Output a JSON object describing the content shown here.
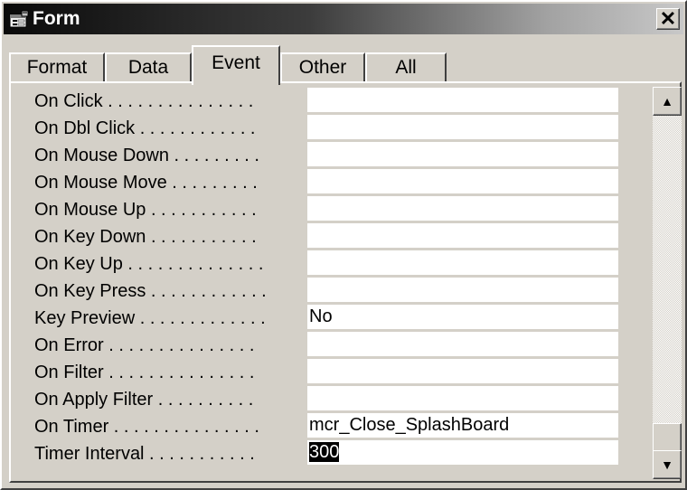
{
  "window": {
    "title": "Form",
    "close_glyph": "✕",
    "icon": "form-properties-icon"
  },
  "tabs": [
    {
      "label": "Format",
      "active": false
    },
    {
      "label": "Data",
      "active": false
    },
    {
      "label": "Event",
      "active": true
    },
    {
      "label": "Other",
      "active": false
    },
    {
      "label": "All",
      "active": false
    }
  ],
  "properties": [
    {
      "label": "On Click . . . . . . . . . . . . . . .",
      "value": ""
    },
    {
      "label": "On Dbl Click . . . . . . . . . . . .",
      "value": ""
    },
    {
      "label": "On Mouse Down . . . . . . . . .",
      "value": ""
    },
    {
      "label": "On Mouse Move . . . . . . . . .",
      "value": ""
    },
    {
      "label": "On Mouse Up . . . . . . . . . . .",
      "value": ""
    },
    {
      "label": "On Key Down . . . . . . . . . . .",
      "value": ""
    },
    {
      "label": "On Key Up . . . . . . . . . . . . . .",
      "value": ""
    },
    {
      "label": "On Key Press . . . . . . . . . . . .",
      "value": ""
    },
    {
      "label": "Key Preview . . . . . . . . . . . . .",
      "value": "No"
    },
    {
      "label": "On Error . . . . . . . . . . . . . . .",
      "value": ""
    },
    {
      "label": "On Filter . . . . . . . . . . . . . . .",
      "value": ""
    },
    {
      "label": "On Apply Filter . . . . . . . . . .",
      "value": ""
    },
    {
      "label": "On Timer . . . . . . . . . . . . . . .",
      "value": "mcr_Close_SplashBoard"
    },
    {
      "label": "Timer Interval . . . . . . . . . . .",
      "value": "300",
      "selected": true
    }
  ],
  "scrollbar": {
    "up_glyph": "▲",
    "down_glyph": "▼",
    "position": 1.0
  },
  "colors": {
    "selection": "#000000",
    "face": "#d4d0c8",
    "title_start": "#0a0a0a",
    "title_end": "#c8c8c8"
  }
}
